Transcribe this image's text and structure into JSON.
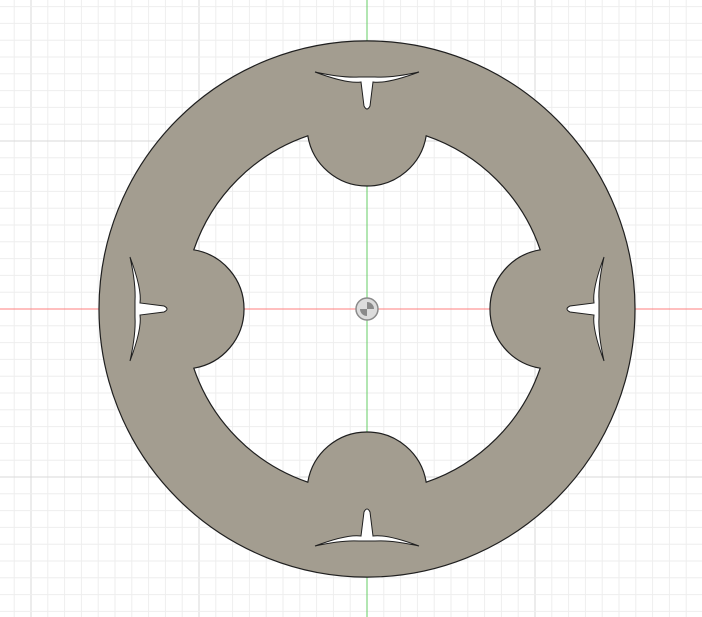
{
  "canvas": {
    "background": "#ffffff",
    "grid_minor_color": "#eeeeee",
    "grid_major_color": "#d9d9d9",
    "x_axis_color": "#ff7f7f",
    "y_axis_color": "#66cc66"
  },
  "part": {
    "description": "ring-with-four-slotted-tabs",
    "fill_color": "#a39d90",
    "edge_color": "#1f1f1f",
    "tab_count": 4
  },
  "origin_marker": {
    "icon": "origin-point-icon",
    "color": "#8a8a8a"
  }
}
